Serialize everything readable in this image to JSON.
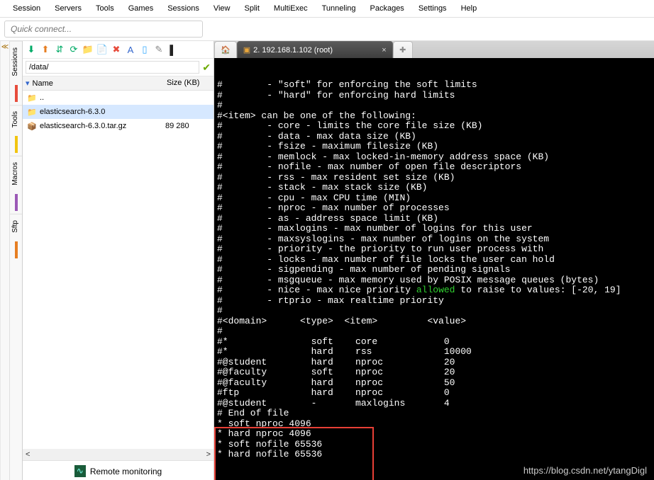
{
  "menu": [
    "Session",
    "Servers",
    "Tools",
    "Games",
    "Sessions",
    "View",
    "Split",
    "MultiExec",
    "Tunneling",
    "Packages",
    "Settings",
    "Help"
  ],
  "quickconnect_placeholder": "Quick connect...",
  "sidetabs": [
    "Sessions",
    "Tools",
    "Macros",
    "Sftp"
  ],
  "toolbar_icons": [
    {
      "name": "download-icon",
      "glyph": "⬇",
      "color": "#0a6"
    },
    {
      "name": "upload-icon",
      "glyph": "⬆",
      "color": "#e67e22"
    },
    {
      "name": "sort-icon",
      "glyph": "⇵",
      "color": "#0a6"
    },
    {
      "name": "refresh-icon",
      "glyph": "⟳",
      "color": "#0a6"
    },
    {
      "name": "new-folder-icon",
      "glyph": "📁",
      "color": "#e9c46a"
    },
    {
      "name": "new-file-icon",
      "glyph": "📄",
      "color": "#f6c"
    },
    {
      "name": "delete-icon",
      "glyph": "✖",
      "color": "#e74c3c"
    },
    {
      "name": "bookmark-icon",
      "glyph": "A",
      "color": "#36c"
    },
    {
      "name": "view-icon",
      "glyph": "▯",
      "color": "#3af"
    },
    {
      "name": "tools-icon",
      "glyph": "✎",
      "color": "#888"
    },
    {
      "name": "terminal-icon",
      "glyph": "▌",
      "color": "#222"
    }
  ],
  "path_value": "/data/",
  "file_columns": {
    "name": "Name",
    "size": "Size (KB)"
  },
  "files": [
    {
      "icon": "folder-up-icon",
      "name": "..",
      "size": "",
      "selected": false
    },
    {
      "icon": "folder-icon",
      "name": "elasticsearch-6.3.0",
      "size": "",
      "selected": true
    },
    {
      "icon": "archive-icon",
      "name": "elasticsearch-6.3.0.tar.gz",
      "size": "89 280",
      "selected": false
    }
  ],
  "remote_monitoring_label": "Remote monitoring",
  "tabs": {
    "active_label": "2. 192.168.1.102 (root)",
    "add_glyph": "✚"
  },
  "terminal_lines": [
    {
      "t": "#        - \"soft\" for enforcing the soft limits"
    },
    {
      "t": "#        - \"hard\" for enforcing hard limits"
    },
    {
      "t": "#"
    },
    {
      "t": "#<item> can be one of the following:"
    },
    {
      "t": "#        - core - limits the core file size (KB)"
    },
    {
      "t": "#        - data - max data size (KB)"
    },
    {
      "t": "#        - fsize - maximum filesize (KB)"
    },
    {
      "t": "#        - memlock - max locked-in-memory address space (KB)"
    },
    {
      "t": "#        - nofile - max number of open file descriptors"
    },
    {
      "t": "#        - rss - max resident set size (KB)"
    },
    {
      "t": "#        - stack - max stack size (KB)"
    },
    {
      "t": "#        - cpu - max CPU time (MIN)"
    },
    {
      "t": "#        - nproc - max number of processes"
    },
    {
      "t": "#        - as - address space limit (KB)"
    },
    {
      "t": "#        - maxlogins - max number of logins for this user"
    },
    {
      "t": "#        - maxsyslogins - max number of logins on the system"
    },
    {
      "t": "#        - priority - the priority to run user process with"
    },
    {
      "t": "#        - locks - max number of file locks the user can hold"
    },
    {
      "t": "#        - sigpending - max number of pending signals"
    },
    {
      "t": "#        - msgqueue - max memory used by POSIX message queues (bytes)"
    },
    {
      "t": "#        - nice - max nice priority ",
      "green": "allowed",
      "t2": " to raise to values: [-20, 19]"
    },
    {
      "t": "#        - rtprio - max realtime priority"
    },
    {
      "t": "#"
    },
    {
      "t": "#<domain>      <type>  <item>         <value>"
    },
    {
      "t": "#"
    },
    {
      "t": ""
    },
    {
      "t": "#*               soft    core            0"
    },
    {
      "t": "#*               hard    rss             10000"
    },
    {
      "t": "#@student        hard    nproc           20"
    },
    {
      "t": "#@faculty        soft    nproc           20"
    },
    {
      "t": "#@faculty        hard    nproc           50"
    },
    {
      "t": "#ftp             hard    nproc           0"
    },
    {
      "t": "#@student        -       maxlogins       4"
    },
    {
      "t": ""
    },
    {
      "t": "# End of file"
    },
    {
      "t": ""
    },
    {
      "t": "* soft nproc 4096"
    },
    {
      "t": "* hard nproc 4096"
    },
    {
      "t": ""
    },
    {
      "t": "* soft nofile 65536"
    },
    {
      "t": "* hard nofile 65536"
    }
  ],
  "watermark": "https://blog.csdn.net/ytangDigl"
}
